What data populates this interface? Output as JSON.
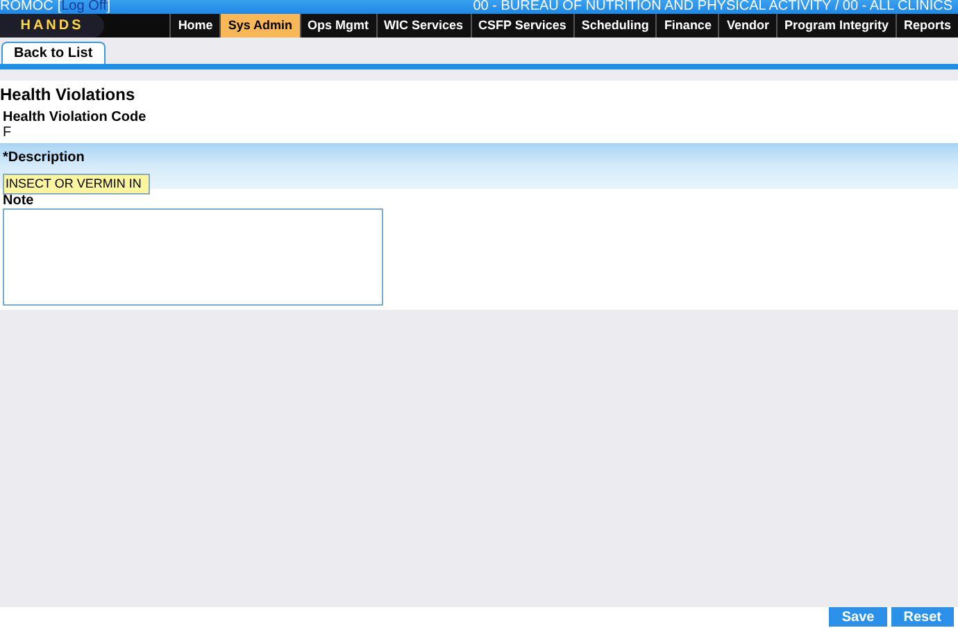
{
  "header": {
    "user": "ROMOC",
    "open_bracket": "[",
    "logoff_link": "Log Off",
    "close_bracket": "]",
    "location": "00 - BUREAU OF NUTRITION AND PHYSICAL ACTIVITY / 00 - ALL CLINICS"
  },
  "logo": "HANDS",
  "nav": [
    {
      "label": "Home",
      "selected": false
    },
    {
      "label": "Sys Admin",
      "selected": true
    },
    {
      "label": "Ops Mgmt",
      "selected": false
    },
    {
      "label": "WIC Services",
      "selected": false
    },
    {
      "label": "CSFP Services",
      "selected": false
    },
    {
      "label": "Scheduling",
      "selected": false
    },
    {
      "label": "Finance",
      "selected": false
    },
    {
      "label": "Vendor",
      "selected": false
    },
    {
      "label": "Program Integrity",
      "selected": false
    },
    {
      "label": "Reports",
      "selected": false
    }
  ],
  "back_button": "Back to List",
  "title": "Health Violations",
  "code": {
    "label": "Health Violation Code",
    "value": "F"
  },
  "description": {
    "label": "*Description",
    "value": "INSECT OR VERMIN IN"
  },
  "note": {
    "label": "Note"
  },
  "buttons": [
    "Save",
    "Reset"
  ]
}
